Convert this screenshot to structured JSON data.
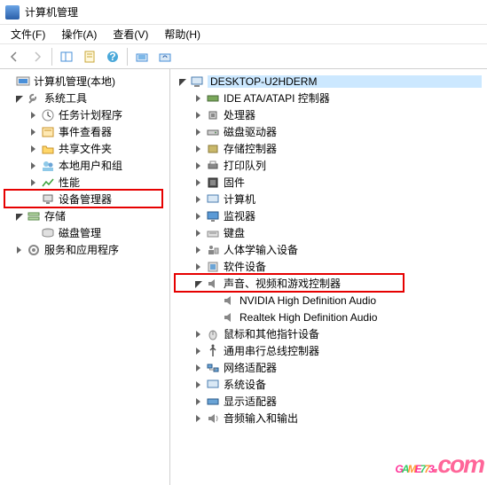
{
  "title": "计算机管理",
  "menu": {
    "file": "文件(F)",
    "action": "操作(A)",
    "view": "查看(V)",
    "help": "帮助(H)"
  },
  "leftTree": {
    "root": "计算机管理(本地)",
    "systemTools": "系统工具",
    "taskScheduler": "任务计划程序",
    "eventViewer": "事件查看器",
    "sharedFolders": "共享文件夹",
    "localUsers": "本地用户和组",
    "performance": "性能",
    "deviceManager": "设备管理器",
    "storage": "存储",
    "diskMgmt": "磁盘管理",
    "services": "服务和应用程序"
  },
  "rightTree": {
    "root": "DESKTOP-U2HDERM",
    "ide": "IDE ATA/ATAPI 控制器",
    "cpu": "处理器",
    "disk": "磁盘驱动器",
    "storage": "存储控制器",
    "print": "打印队列",
    "firmware": "固件",
    "computer": "计算机",
    "monitor": "监视器",
    "keyboard": "键盘",
    "hid": "人体学输入设备",
    "software": "软件设备",
    "sound": "声音、视频和游戏控制器",
    "sound1": "NVIDIA High Definition Audio",
    "sound2": "Realtek High Definition Audio",
    "mouse": "鼠标和其他指针设备",
    "usb": "通用串行总线控制器",
    "network": "网络适配器",
    "system": "系统设备",
    "display": "显示适配器",
    "audioIO": "音频输入和输出"
  },
  "watermark": {
    "text": "GAME773",
    "suffix": ".com"
  }
}
